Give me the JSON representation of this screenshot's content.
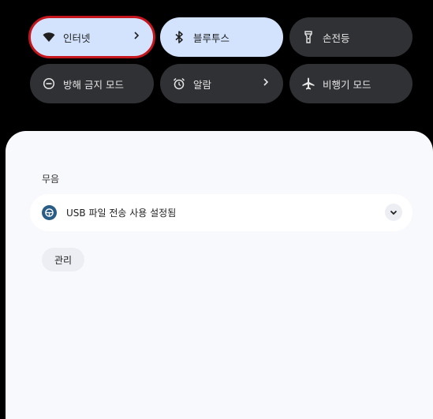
{
  "quick_settings": {
    "internet": {
      "label": "인터넷",
      "icon": "wifi-icon"
    },
    "bluetooth": {
      "label": "블루투스",
      "icon": "bluetooth-icon"
    },
    "flashlight": {
      "label": "손전등",
      "icon": "flashlight-icon"
    },
    "dnd": {
      "label": "방해 금지 모드",
      "icon": "do-not-disturb-icon"
    },
    "alarm": {
      "label": "알람",
      "icon": "alarm-icon"
    },
    "airplane": {
      "label": "비행기 모드",
      "icon": "airplane-icon"
    }
  },
  "notifications": {
    "section_label": "무음",
    "items": [
      {
        "text": "USB 파일 전송 사용 설정됨",
        "icon": "usb-icon"
      }
    ],
    "manage_label": "관리"
  },
  "colors": {
    "active_tile": "#d3e3fd",
    "inactive_tile": "#303134",
    "highlight": "#c5161d",
    "app_icon": "#2a5d86"
  }
}
